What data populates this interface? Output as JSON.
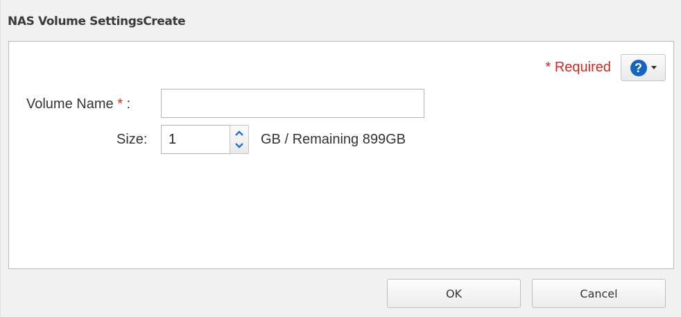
{
  "dialog": {
    "title": "NAS Volume SettingsCreate"
  },
  "form": {
    "required_star": "*",
    "required_label": "Required",
    "help_glyph": "?",
    "volume_name_label": "Volume Name",
    "volume_name_suffix": " :",
    "volume_name_value": "",
    "size_label": "Size:",
    "size_value": "1",
    "size_unit_text": "GB / Remaining 899GB"
  },
  "buttons": {
    "ok": "OK",
    "cancel": "Cancel"
  },
  "colors": {
    "required": "#d8261e",
    "help_icon": "#1565c0",
    "spinner_arrow": "#1e74c8"
  },
  "icons": {
    "help": "question-circle-icon",
    "dropdown": "caret-down-icon",
    "spinner_up": "chevron-up-icon",
    "spinner_down": "chevron-down-icon"
  }
}
